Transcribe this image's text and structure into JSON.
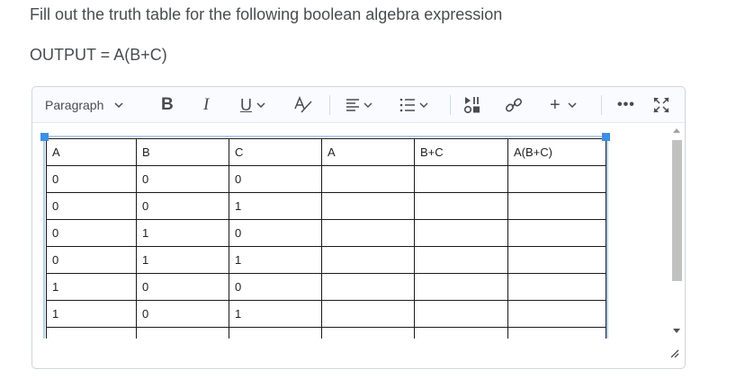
{
  "question": {
    "prompt": "Fill out the truth table for the following boolean algebra expression",
    "expression": "OUTPUT = A(B+C)"
  },
  "toolbar": {
    "format_label": "Paragraph",
    "bold_label": "B",
    "italic_label": "I",
    "underline_label": "U",
    "insert_label": "+",
    "more_label": "•••",
    "icons": [
      "chevron-down-icon",
      "font-color-icon",
      "align-icon",
      "list-icon",
      "media-icon",
      "link-icon",
      "more-icon",
      "fullscreen-icon"
    ]
  },
  "table": {
    "headers": [
      "A",
      "B",
      "C",
      "A",
      "B+C",
      "A(B+C)"
    ],
    "rows": [
      [
        "0",
        "0",
        "0",
        "",
        "",
        ""
      ],
      [
        "0",
        "0",
        "1",
        "",
        "",
        ""
      ],
      [
        "0",
        "1",
        "0",
        "",
        "",
        ""
      ],
      [
        "0",
        "1",
        "1",
        "",
        "",
        ""
      ],
      [
        "1",
        "0",
        "0",
        "",
        "",
        ""
      ],
      [
        "1",
        "0",
        "1",
        "",
        "",
        ""
      ]
    ]
  },
  "colors": {
    "selection_handle": "#3b8fe6",
    "selection_border": "#b4d0f2",
    "text": "#494c4e",
    "toolbar_bg": "#f9fbff"
  }
}
